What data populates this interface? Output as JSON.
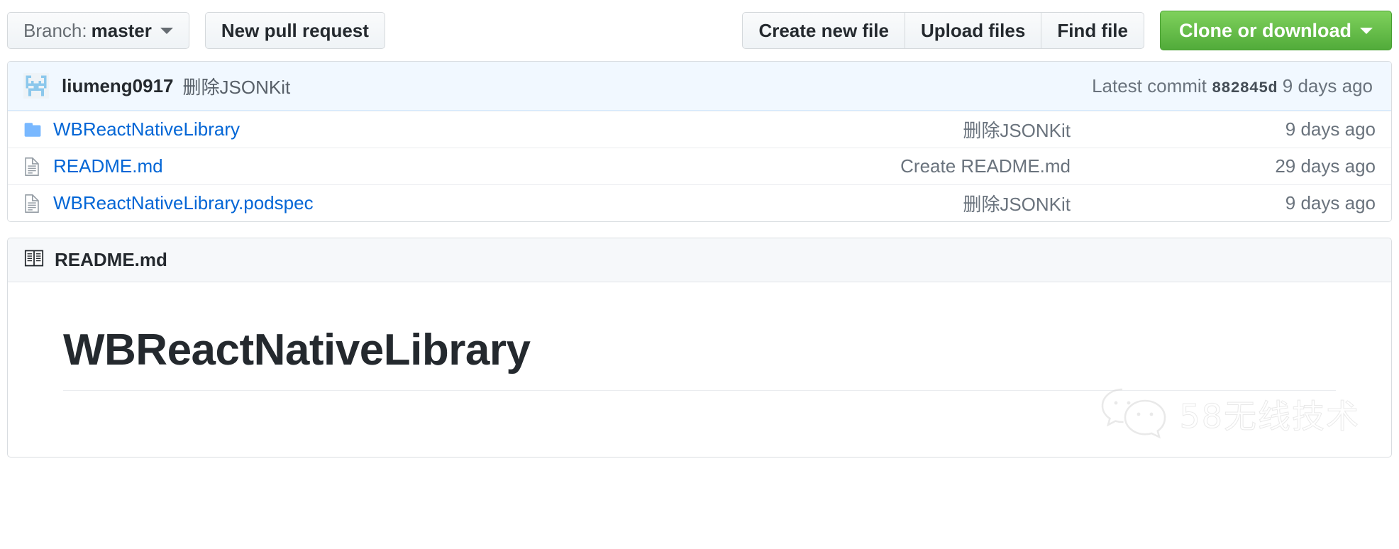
{
  "toolbar": {
    "branch_prefix": "Branch:",
    "branch_name": "master",
    "new_pull_request": "New pull request",
    "create_new_file": "Create new file",
    "upload_files": "Upload files",
    "find_file": "Find file",
    "clone_or_download": "Clone or download",
    "green_accent": "#51ab3a"
  },
  "commit_bar": {
    "author": "liumeng0917",
    "message": "删除JSONKit",
    "latest_label": "Latest commit",
    "sha": "882845d",
    "age": "9 days ago",
    "background": "#f1f8ff"
  },
  "files": [
    {
      "icon": "folder-icon",
      "name": "WBReactNativeLibrary",
      "message": "删除JSONKit",
      "age": "9 days ago"
    },
    {
      "icon": "file-icon",
      "name": "README.md",
      "message": "Create README.md",
      "age": "29 days ago"
    },
    {
      "icon": "file-icon",
      "name": "WBReactNativeLibrary.podspec",
      "message": "删除JSONKit",
      "age": "9 days ago"
    }
  ],
  "readme": {
    "header_title": "README.md",
    "heading": "WBReactNativeLibrary"
  },
  "watermark": {
    "text": "58无线技术"
  }
}
